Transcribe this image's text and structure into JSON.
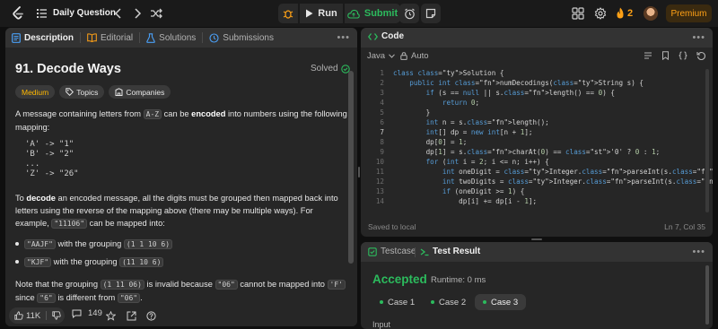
{
  "topbar": {
    "title": "Daily Question",
    "run_label": "Run",
    "submit_label": "Submit",
    "streak": "2",
    "premium_label": "Premium"
  },
  "left_tabs": [
    {
      "label": "Description",
      "icon": "description-icon"
    },
    {
      "label": "Editorial",
      "icon": "book-icon"
    },
    {
      "label": "Solutions",
      "icon": "flask-icon"
    },
    {
      "label": "Submissions",
      "icon": "history-icon"
    }
  ],
  "problem": {
    "title": "91. Decode Ways",
    "status": "Solved",
    "difficulty": "Medium",
    "topics_label": "Topics",
    "companies_label": "Companies",
    "p1_a": "A message containing letters from ",
    "p1_code": "A-Z",
    "p1_b": " can be ",
    "p1_bold": "encoded",
    "p1_c": " into numbers using the following mapping:",
    "mapping": "'A' -> \"1\"\n'B' -> \"2\"\n...\n'Z' -> \"26\"",
    "p2_a": "To ",
    "p2_bold": "decode",
    "p2_b": " an encoded message, all the digits must be grouped then mapped back into letters using the reverse of the mapping above (there may be multiple ways). For example, ",
    "p2_code": "\"11106\"",
    "p2_c": " can be mapped into:",
    "b1_code": "\"AAJF\"",
    "b1_text": " with the grouping ",
    "b1_group": "(1 1 10 6)",
    "b2_code": "\"KJF\"",
    "b2_text": " with the grouping ",
    "b2_group": "(11 10 6)",
    "p3_a": "Note that the grouping ",
    "p3_code1": "(1 11 06)",
    "p3_b": " is invalid because ",
    "p3_code2": "\"06\"",
    "p3_c": " cannot be mapped into ",
    "p3_code3": "'F'",
    "p3_d": " since ",
    "p3_code4": "\"6\"",
    "p3_e": " is different from ",
    "p3_code5": "\"06\"",
    "p3_f": "."
  },
  "footer": {
    "likes": "11K",
    "comments": "149"
  },
  "code_panel": {
    "title": "Code",
    "language": "Java",
    "mode": "Auto",
    "saved": "Saved to local",
    "cursor": "Ln 7, Col 35"
  },
  "code_lines": [
    "class Solution {",
    "    public int numDecodings(String s) {",
    "        if (s == null || s.length() == 0) {",
    "            return 0;",
    "        }",
    "        int n = s.length();",
    "        int[] dp = new int[n + 1];",
    "        dp[0] = 1;",
    "        dp[1] = s.charAt(0) == '0' ? 0 : 1;",
    "        for (int i = 2; i <= n; i++) {",
    "            int oneDigit = Integer.parseInt(s.substring(i - 1, i));",
    "            int twoDigits = Integer.parseInt(s.substring(i - 2, i));",
    "            if (oneDigit >= 1) {",
    "                dp[i] += dp[i - 1];"
  ],
  "result_panel": {
    "tab_testcase": "Testcase",
    "tab_result": "Test Result",
    "verdict": "Accepted",
    "runtime": "Runtime: 0 ms",
    "cases": [
      "Case 1",
      "Case 2",
      "Case 3"
    ],
    "input_label": "Input"
  },
  "colors": {
    "accent_orange": "#ffa116",
    "accepted_green": "#2cbb5d",
    "medium_yellow": "#ffb800"
  }
}
